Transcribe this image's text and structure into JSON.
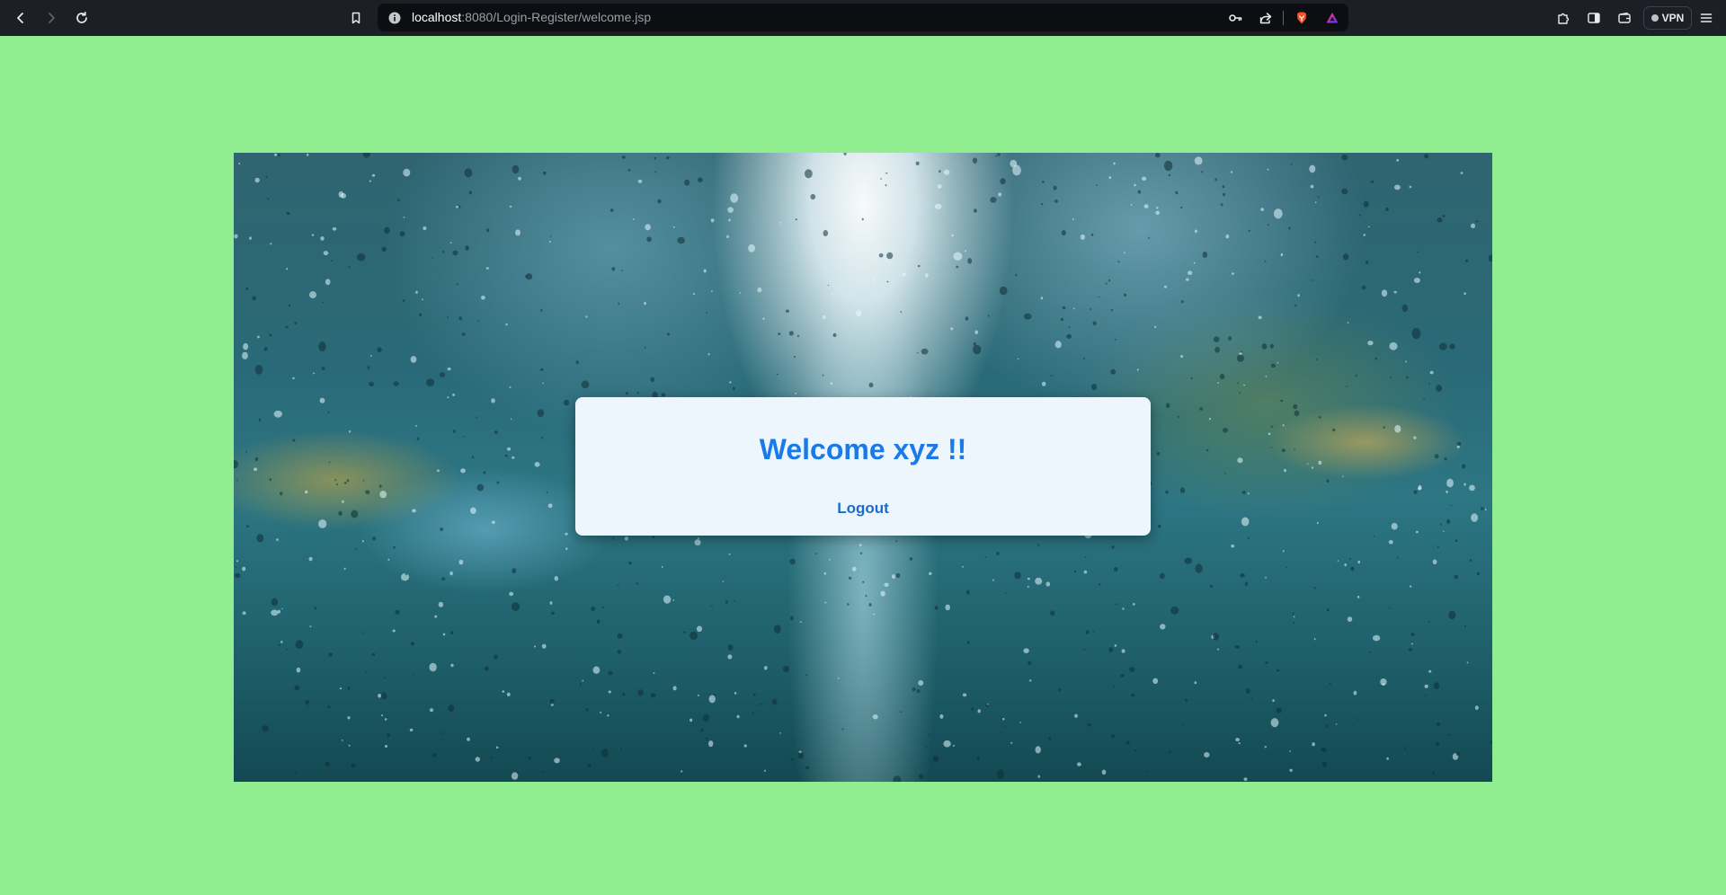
{
  "browser": {
    "url_host": "localhost",
    "url_rest": ":8080/Login-Register/welcome.jsp",
    "vpn_label": "VPN"
  },
  "icons": {
    "back": "back-arrow-icon",
    "forward": "forward-arrow-icon",
    "reload": "reload-icon",
    "bookmark": "bookmark-icon",
    "site_info": "info-icon",
    "password": "key-icon",
    "share": "share-icon",
    "brave_shields": "brave-lion-icon",
    "brave_rewards": "triangle-rewards-icon",
    "extensions": "puzzle-icon",
    "sidebar": "sidebar-icon",
    "wallet": "wallet-icon",
    "menu": "hamburger-menu-icon"
  },
  "colors": {
    "page_background": "#90ee90",
    "welcome_text": "#1a7ae8",
    "card_background": "#eef6fd"
  },
  "welcome": {
    "heading": "Welcome xyz !!",
    "logout_label": "Logout"
  }
}
